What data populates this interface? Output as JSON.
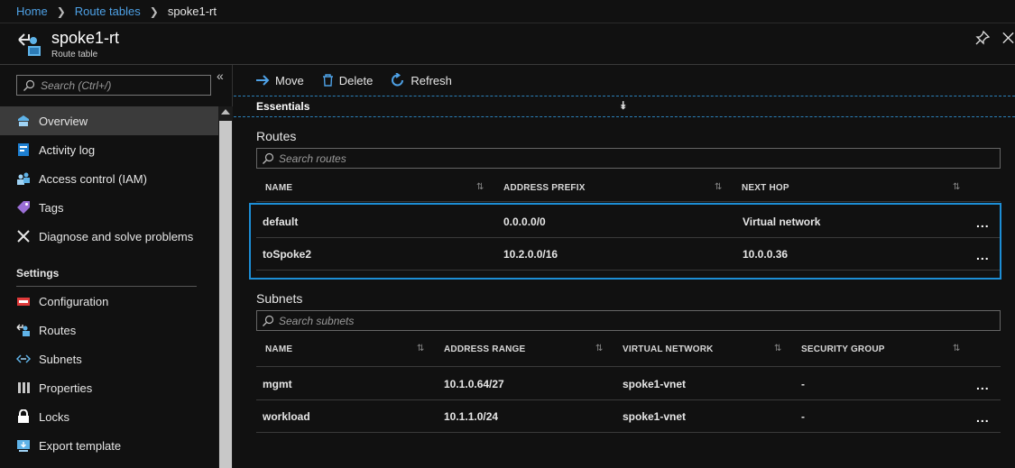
{
  "breadcrumb": {
    "home": "Home",
    "route_tables": "Route tables",
    "current": "spoke1-rt"
  },
  "resource": {
    "title": "spoke1-rt",
    "subtitle": "Route table",
    "icon": "route-table-icon"
  },
  "sidebar": {
    "search_placeholder": "Search (Ctrl+/)",
    "items": [
      {
        "label": "Overview",
        "icon": "overview-icon",
        "active": true
      },
      {
        "label": "Activity log",
        "icon": "activity-log-icon"
      },
      {
        "label": "Access control (IAM)",
        "icon": "iam-icon"
      },
      {
        "label": "Tags",
        "icon": "tag-icon"
      },
      {
        "label": "Diagnose and solve problems",
        "icon": "wrench-icon"
      }
    ],
    "settings_heading": "Settings",
    "settings_items": [
      {
        "label": "Configuration",
        "icon": "configuration-icon"
      },
      {
        "label": "Routes",
        "icon": "routes-icon"
      },
      {
        "label": "Subnets",
        "icon": "subnets-icon"
      },
      {
        "label": "Properties",
        "icon": "properties-icon"
      },
      {
        "label": "Locks",
        "icon": "lock-icon"
      },
      {
        "label": "Export template",
        "icon": "export-template-icon"
      }
    ]
  },
  "toolbar": {
    "move": "Move",
    "delete": "Delete",
    "refresh": "Refresh"
  },
  "essentials": {
    "label": "Essentials"
  },
  "routes": {
    "title": "Routes",
    "search_placeholder": "Search routes",
    "columns": [
      "NAME",
      "ADDRESS PREFIX",
      "NEXT HOP"
    ],
    "rows": [
      {
        "name": "default",
        "prefix": "0.0.0.0/0",
        "next_hop": "Virtual network"
      },
      {
        "name": "toSpoke2",
        "prefix": "10.2.0.0/16",
        "next_hop": "10.0.0.36"
      }
    ]
  },
  "subnets": {
    "title": "Subnets",
    "search_placeholder": "Search subnets",
    "columns": [
      "NAME",
      "ADDRESS RANGE",
      "VIRTUAL NETWORK",
      "SECURITY GROUP"
    ],
    "rows": [
      {
        "name": "mgmt",
        "range": "10.1.0.64/27",
        "vnet": "spoke1-vnet",
        "nsg": "-"
      },
      {
        "name": "workload",
        "range": "10.1.1.0/24",
        "vnet": "spoke1-vnet",
        "nsg": "-"
      }
    ]
  },
  "misc": {
    "ellipsis": "...",
    "sort_glyph": "⇅",
    "collapse_glyph": "«",
    "chevron_glyph": "⌄"
  },
  "colors": {
    "accent": "#1d8ed6",
    "link": "#4ea1e6",
    "background": "#111111"
  }
}
